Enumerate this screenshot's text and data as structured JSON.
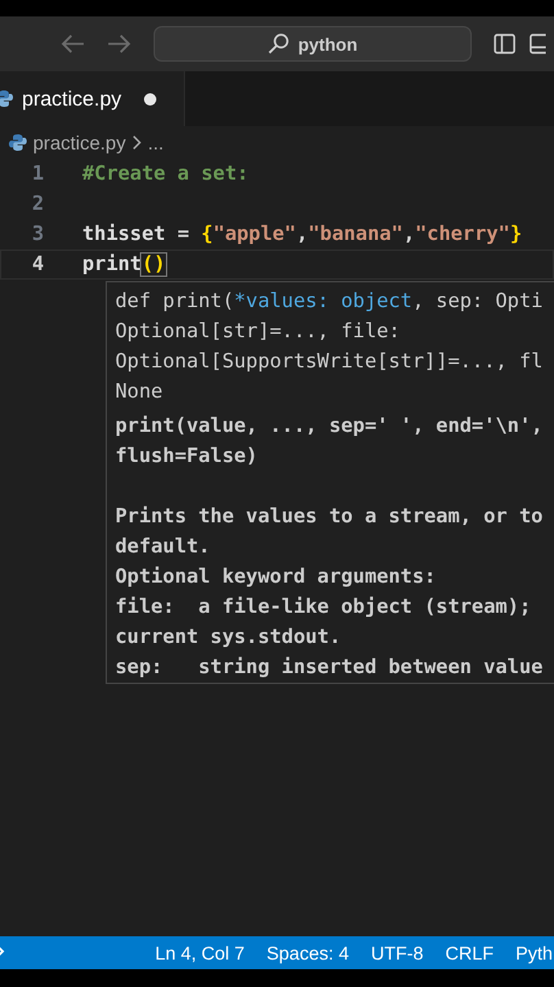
{
  "title_bar": {
    "back_disabled": true,
    "forward_disabled": true,
    "search": {
      "value": "python"
    }
  },
  "tabs": [
    {
      "label": "practice.py",
      "selected": true,
      "modified": true
    }
  ],
  "breadcrumb": {
    "file": "practice.py",
    "more": "..."
  },
  "code": [
    {
      "number": "1",
      "active": false,
      "tokens": [
        {
          "kind": "comment",
          "text": "#Create a set:"
        }
      ]
    },
    {
      "number": "2",
      "active": false
    },
    {
      "number": "3",
      "active": false,
      "tokens": [
        {
          "kind": "ident",
          "text": "thisset "
        },
        {
          "kind": "op",
          "text": "= "
        },
        {
          "kind": "bracket",
          "text": "{"
        },
        {
          "kind": "string",
          "text": "\"apple\""
        },
        {
          "kind": "op",
          "text": ","
        },
        {
          "kind": "string",
          "text": "\"banana\""
        },
        {
          "kind": "op",
          "text": ","
        },
        {
          "kind": "string",
          "text": "\"cherry\""
        },
        {
          "kind": "bracket",
          "text": "}"
        }
      ]
    },
    {
      "number": "4",
      "active": true,
      "tokens": [
        {
          "kind": "ident",
          "text": "print"
        },
        {
          "kind": "match",
          "text": "()"
        }
      ]
    }
  ],
  "hover": {
    "signature": [
      [
        {
          "kind": "plain",
          "text": "def print("
        },
        {
          "kind": "param",
          "text": "*values: object"
        },
        {
          "kind": "plain",
          "text": ", sep: Opti"
        }
      ],
      [
        {
          "kind": "plain",
          "text": "Optional[str]=..., file:"
        }
      ],
      [
        {
          "kind": "plain",
          "text": "Optional[SupportsWrite[str]]=..., fl"
        }
      ],
      [
        {
          "kind": "plain",
          "text": "None"
        }
      ]
    ],
    "usage": [
      "print(value, ..., sep=' ', end='\\n',",
      "flush=False)"
    ],
    "doc": [
      "Prints the values to a stream, or to",
      "default.",
      "Optional keyword arguments:",
      "file:  a file-like object (stream);",
      "current sys.stdout.",
      "sep:   string inserted between value"
    ]
  },
  "status_bar": {
    "items": [
      "Ln 4, Col 7",
      "Spaces: 4",
      "UTF-8",
      "CRLF",
      "Pyth"
    ]
  }
}
